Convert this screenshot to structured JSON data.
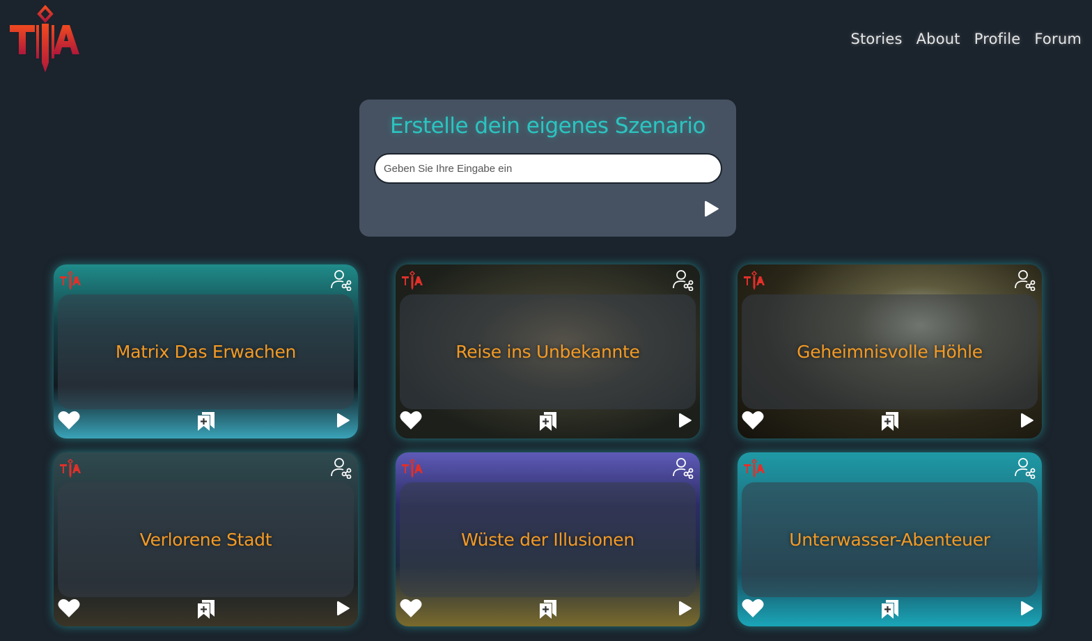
{
  "logo": {
    "text": "TIA",
    "icon": "tia-logo"
  },
  "nav": {
    "items": [
      "Stories",
      "About",
      "Profile",
      "Forum"
    ]
  },
  "create": {
    "title": "Erstelle dein eigenes Szenario",
    "input_placeholder": "Geben Sie Ihre Eingabe ein",
    "input_value": "",
    "submit_icon": "play-icon"
  },
  "cards": [
    {
      "title": "Matrix Das Erwachen",
      "theme": "matrix"
    },
    {
      "title": "Reise ins Unbekannte",
      "theme": "forest"
    },
    {
      "title": "Geheimnisvolle Höhle",
      "theme": "cave"
    },
    {
      "title": "Verlorene Stadt",
      "theme": "city"
    },
    {
      "title": "Wüste der Illusionen",
      "theme": "castle"
    },
    {
      "title": "Unterwasser-Abenteuer",
      "theme": "underwater"
    }
  ],
  "colors": {
    "background": "#1b232c",
    "panel": "#465261",
    "accent_teal": "#2cc4c0",
    "card_title": "#f39a24",
    "logo_red": "#e0302a"
  }
}
